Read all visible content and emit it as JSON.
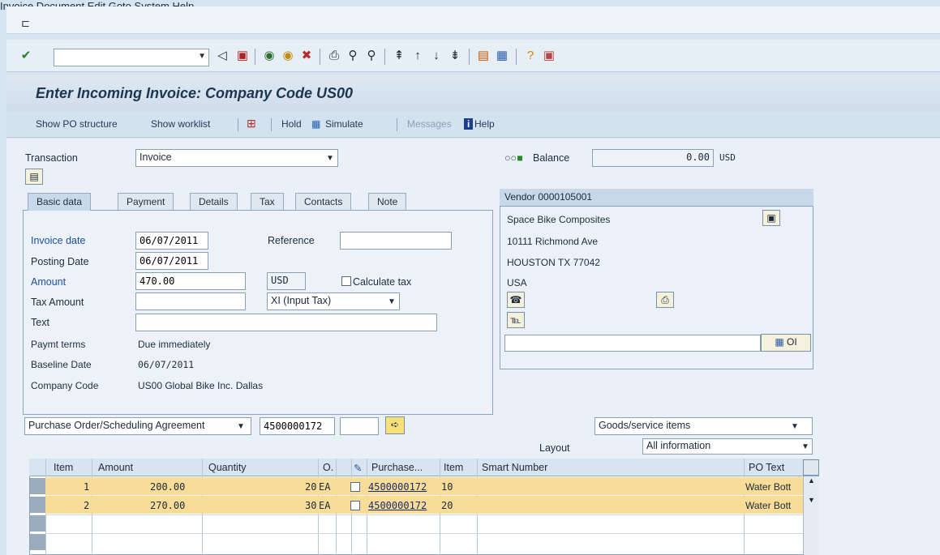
{
  "menu": {
    "items": [
      "Invoice Document",
      "Edit",
      "Goto",
      "System",
      "Help"
    ]
  },
  "title": "Enter Incoming Invoice: Company Code US00",
  "app_toolbar": {
    "show_po_structure": "Show PO structure",
    "show_worklist": "Show worklist",
    "hold": "Hold",
    "simulate": "Simulate",
    "messages": "Messages",
    "help": "Help"
  },
  "header": {
    "transaction_label": "Transaction",
    "transaction_value": "Invoice",
    "balance_label": "Balance",
    "balance_value": "0.00",
    "balance_currency": "USD"
  },
  "tabs": [
    "Basic data",
    "Payment",
    "Details",
    "Tax",
    "Contacts",
    "Note"
  ],
  "basic": {
    "invoice_date_label": "Invoice date",
    "invoice_date": "06/07/2011",
    "reference_label": "Reference",
    "reference": "",
    "posting_date_label": "Posting Date",
    "posting_date": "06/07/2011",
    "amount_label": "Amount",
    "amount": "470.00",
    "currency": "USD",
    "calculate_tax_label": "Calculate tax",
    "tax_amount_label": "Tax Amount",
    "tax_amount": "",
    "tax_code": "XI (Input Tax)",
    "text_label": "Text",
    "text": "",
    "paymt_terms_label": "Paymt terms",
    "paymt_terms": "Due immediately",
    "baseline_date_label": "Baseline Date",
    "baseline_date": "06/07/2011",
    "company_code_label": "Company Code",
    "company_code": "US00 Global Bike Inc. Dallas"
  },
  "vendor": {
    "header": "Vendor 0000105001",
    "name": "Space Bike Composites",
    "street": "10111 Richmond Ave",
    "city": "HOUSTON TX  77042",
    "country": "USA",
    "oi_label": "OI"
  },
  "reference_doc": {
    "type": "Purchase Order/Scheduling Agreement",
    "po_number": "4500000172",
    "item": "",
    "items_view": "Goods/service items",
    "layout_label": "Layout",
    "layout_value": "All information"
  },
  "table": {
    "columns": [
      "Item",
      "Amount",
      "Quantity",
      "O.",
      "Purchase...",
      "Item",
      "Smart Number",
      "PO Text"
    ],
    "rows": [
      {
        "item": "1",
        "amount": "200.00",
        "quantity": "20",
        "unit": "EA",
        "po": "4500000172",
        "po_item": "10",
        "smart": "",
        "po_text": "Water Bott"
      },
      {
        "item": "2",
        "amount": "270.00",
        "quantity": "30",
        "unit": "EA",
        "po": "4500000172",
        "po_item": "20",
        "smart": "",
        "po_text": "Water Bott"
      }
    ]
  }
}
